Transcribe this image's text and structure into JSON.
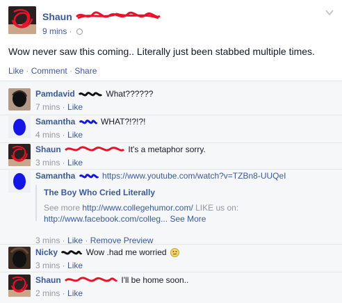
{
  "post": {
    "author": "Shaun",
    "time": "9 mins",
    "text": "Wow never saw this coming.. Literally just been stabbed multiple times.",
    "actions": {
      "like": "Like",
      "comment": "Comment",
      "share": "Share"
    },
    "sep1": " · ",
    "sep2": " · "
  },
  "comments": [
    {
      "author": "Pamdavid",
      "text": "What??????",
      "time": "7 mins",
      "like": "Like"
    },
    {
      "author": "Samantha",
      "text": "WHAT?!?!?!",
      "time": "4 mins",
      "like": "Like"
    },
    {
      "author": "Shaun",
      "text": "It's a metaphor sorry.",
      "time": "3 mins",
      "like": "Like"
    },
    {
      "author": "Samantha",
      "text": "https://www.youtube.com/watch?v=TZBn8-UUQeI",
      "preview": {
        "title": "The Boy Who Cried Literally",
        "see_more": "See more",
        "url1": "http://www.collegehumor.com/",
        "like_us": "LIKE us on:",
        "url2": "http://www.facebook.com/colleg...",
        "see_more2": "See More"
      },
      "time": "3 mins",
      "like": "Like",
      "remove": "Remove Preview"
    },
    {
      "author": "Nicky",
      "text": "Wow .had me worried",
      "time": "3 mins",
      "like": "Like"
    },
    {
      "author": "Shaun",
      "text": "I'll be home soon..",
      "time": "2 mins",
      "like": "Like"
    }
  ],
  "dot": " · ",
  "icons": {
    "menu": "chevron-down-icon",
    "privacy": "globe-icon",
    "emoji": "smiley-icon"
  },
  "colors": {
    "link": "#3b5998",
    "muted": "#9197a3",
    "redact_red": "#e8132a",
    "redact_blue": "#1414e6",
    "redact_black": "#111111"
  }
}
